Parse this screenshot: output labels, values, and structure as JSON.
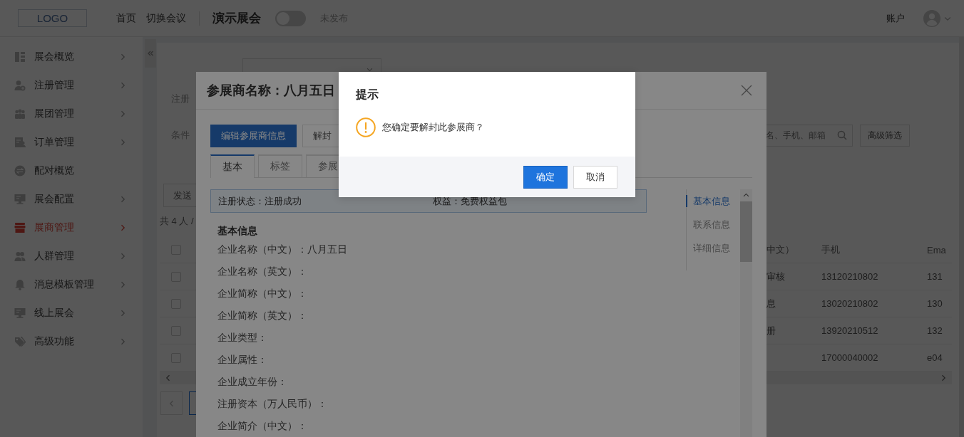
{
  "header": {
    "logo": "LOGO",
    "nav": [
      {
        "label": "首页"
      },
      {
        "label": "切换会议"
      }
    ],
    "event_name": "演示展会",
    "publish_toggle": {
      "on": false
    },
    "publish_status": "未发布",
    "account": "账户"
  },
  "sidebar": {
    "items": [
      {
        "label": "展会概览",
        "selected": false,
        "has_submenu": true
      },
      {
        "label": "注册管理",
        "selected": false,
        "has_submenu": true
      },
      {
        "label": "展团管理",
        "selected": false,
        "has_submenu": true
      },
      {
        "label": "订单管理",
        "selected": false,
        "has_submenu": true
      },
      {
        "label": "配对概览",
        "selected": false,
        "has_submenu": false
      },
      {
        "label": "展会配置",
        "selected": false,
        "has_submenu": true
      },
      {
        "label": "展商管理",
        "selected": true,
        "has_submenu": true
      },
      {
        "label": "人群管理",
        "selected": false,
        "has_submenu": true
      },
      {
        "label": "消息模板管理",
        "selected": false,
        "has_submenu": true
      },
      {
        "label": "线上展会",
        "selected": false,
        "has_submenu": true
      },
      {
        "label": "高级功能",
        "selected": false,
        "has_submenu": true
      }
    ]
  },
  "filters": {
    "row_2_label": "注册",
    "row_3_label": "条件",
    "search": {
      "placeholder": "名、手机、邮箱"
    },
    "advanced_filter": "高级筛选"
  },
  "toolbar": {
    "send_button": "发送",
    "count": "共 4 人 /"
  },
  "table": {
    "select_all": {
      "checked": false
    },
    "columns": [
      "中文）",
      "手机",
      "Ema"
    ],
    "rows": [
      {
        "checked": false,
        "cells": [
          "审核",
          "13120210802",
          "131"
        ]
      },
      {
        "checked": false,
        "cells": [
          "息",
          "13020210802",
          "130"
        ]
      },
      {
        "checked": false,
        "cells": [
          "册",
          "13920210512",
          "132"
        ]
      },
      {
        "checked": false,
        "cells": [
          "",
          "17000040002",
          "e04"
        ]
      }
    ]
  },
  "exhibitor_modal": {
    "title": "参展商名称：八月五日",
    "actions": [
      {
        "label": "编辑参展商信息",
        "kind": "primary"
      },
      {
        "label": "解封",
        "kind": "default"
      }
    ],
    "tabs": [
      {
        "label": "基本",
        "selected": true
      },
      {
        "label": "标签",
        "selected": false
      },
      {
        "label": "参展",
        "selected": false
      }
    ],
    "status_bar": {
      "registration": "注册状态：注册成功",
      "benefit": "权益：免费权益包"
    },
    "section_title": "基本信息",
    "fields": [
      "企业名称（中文）：八月五日",
      "企业名称（英文）：",
      "企业简称（中文）：",
      "企业简称（英文）：",
      "企业类型：",
      "企业属性：",
      "企业成立年份：",
      "注册资本（万人民币）：",
      "企业简介（中文）："
    ],
    "anchors": [
      {
        "label": "基本信息",
        "selected": true
      },
      {
        "label": "联系信息",
        "selected": false
      },
      {
        "label": "详细信息",
        "selected": false
      }
    ]
  },
  "confirm_dialog": {
    "title": "提示",
    "message": "您确定要解封此参展商？",
    "buttons": [
      {
        "label": "确定",
        "kind": "primary"
      },
      {
        "label": "取消",
        "kind": "default"
      }
    ]
  }
}
